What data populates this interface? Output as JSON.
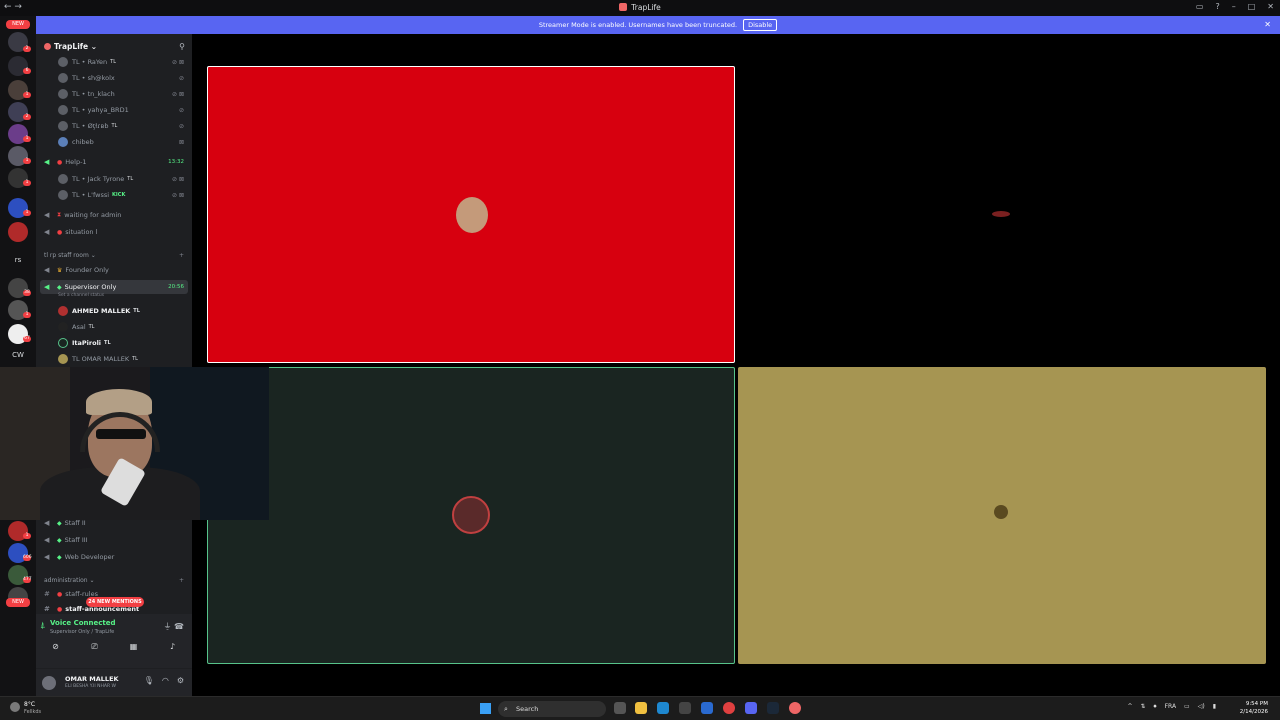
{
  "window": {
    "title": "TrapLife"
  },
  "banner": {
    "text": "Streamer Mode is enabled. Usernames have been truncated.",
    "disable_label": "Disable"
  },
  "rail": {
    "new_label": "NEW",
    "rs_label": "rs",
    "cw_label": "CW",
    "badges": [
      "2",
      "6",
      "1",
      "2",
      "1",
      "1",
      "1",
      "1",
      "38",
      "1",
      "67",
      "1",
      "606",
      "477",
      "2"
    ]
  },
  "server": {
    "name": "TrapLife"
  },
  "channels": {
    "members_top": [
      {
        "prefix": "TL",
        "name": "RaYen",
        "tag": "TL"
      },
      {
        "prefix": "TL",
        "name": "sh@kolx",
        "tag": ""
      },
      {
        "prefix": "TL",
        "name": "tn_klach",
        "tag": ""
      },
      {
        "prefix": "TL",
        "name": "yahya_BRD1",
        "tag": ""
      },
      {
        "prefix": "TL",
        "name": "Øţłɾвb",
        "tag": "TL"
      },
      {
        "prefix": "",
        "name": "chibeb",
        "tag": ""
      }
    ],
    "help_channel": {
      "name": "Help-1",
      "time": "13:32"
    },
    "help_members": [
      {
        "prefix": "TL",
        "name": "Jack Tyrone",
        "tag": "TL"
      },
      {
        "prefix": "TL",
        "name": "L'fwssi",
        "tag": "KICK"
      }
    ],
    "waiting": "waiting for admin",
    "situation": "situation l",
    "staff_category": "tl rp staff room",
    "founder_only": "Founder Only",
    "supervisor_only": {
      "name": "Supervisor Only",
      "time": "20:56",
      "status_hint": "Set a channel status"
    },
    "supervisor_members": [
      {
        "name": "AHMED MALLEK",
        "tag": "TL"
      },
      {
        "name": "Asal",
        "tag": "TL"
      },
      {
        "name": "ItaPiroli",
        "tag": "TL"
      },
      {
        "name": "TL OMAR MALLEK",
        "tag": "TL"
      }
    ],
    "staff_2": "Staff II",
    "staff_3": "Staff III",
    "web_dev": "Web Developer",
    "admin_category": "administration",
    "staff_rules": "staff-rules",
    "staff_announcement": "staff-announcement",
    "mentions_label": "24 NEW MENTIONS"
  },
  "voice": {
    "status": "Voice Connected",
    "location": "Supervisor Only / TrapLife"
  },
  "user": {
    "name": "OMAR MALLEK",
    "status": "ELI BESHA Y.II NHAR W"
  },
  "taskbar": {
    "weather_temp": "8°C",
    "weather_desc": "Fellkds",
    "search_label": "Search",
    "lang": "FRA",
    "time": "9:54 PM",
    "date": "2/14/2026"
  },
  "colors": {
    "accent": "#5865f2",
    "tile_red": "#d7000f",
    "tile_dark": "#1a2521",
    "tile_gold": "#a69552",
    "speaking_green": "#57c38a"
  }
}
